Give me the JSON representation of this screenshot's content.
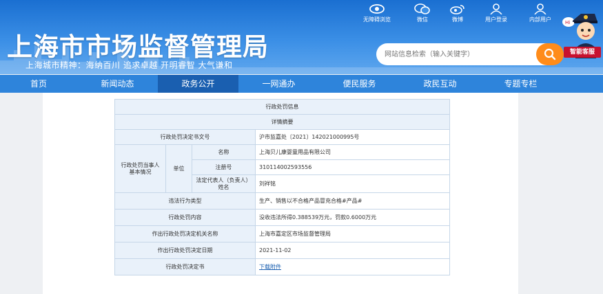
{
  "header": {
    "title": "上海市市场监督管理局",
    "spirit": "上海城市精神：海纳百川   追求卓越   开明睿智   大气谦和",
    "search_placeholder": "网站信息检索（输入关键字）",
    "tools": [
      {
        "label": "无障碍浏览",
        "icon": "eye-icon"
      },
      {
        "label": "微信",
        "icon": "wechat-icon"
      },
      {
        "label": "微博",
        "icon": "weibo-icon"
      },
      {
        "label": "用户登录",
        "icon": "user-icon"
      },
      {
        "label": "内部用户",
        "icon": "user-icon"
      }
    ],
    "helper_label": "智能客服"
  },
  "nav": {
    "items": [
      "首页",
      "新闻动态",
      "政务公开",
      "一网通办",
      "便民服务",
      "政民互动",
      "专题专栏"
    ],
    "active_index": 2
  },
  "detail": {
    "title": "行政处罚信息",
    "subtitle": "详情摘要",
    "decision_no_label": "行政处罚决定书文号",
    "decision_no": "沪市监嘉处〔2021〕142021000995号",
    "party_label": "行政处罚当事人基本情况",
    "unit_label": "单位",
    "name_label": "名称",
    "name": "上海贝儿康婴童用品有限公司",
    "reg_label": "注册号",
    "reg": "310114002593556",
    "rep_label": "法定代表人（负责人）姓名",
    "rep": "刘祥铭",
    "violation_label": "违法行为类型",
    "violation": "生产、销售以不合格产品冒充合格#产品#",
    "content_label": "行政处罚内容",
    "content": "没收违法所得0.388539万元，罚款0.6000万元",
    "authority_label": "作出行政处罚决定机关名称",
    "authority": "上海市嘉定区市场监督管理局",
    "date_label": "作出行政处罚决定日期",
    "date": "2021-11-02",
    "doc_label": "行政处罚决定书",
    "doc_link": "下载附件"
  },
  "colors": {
    "header_blue": "#1a6fd1",
    "nav_blue": "#2e84db",
    "nav_active": "#1a5fb0",
    "search_orange": "#ff8c1a"
  }
}
